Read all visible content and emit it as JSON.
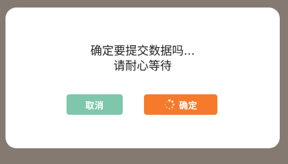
{
  "dialog": {
    "message_line1": "确定要提交数据吗...",
    "message_line2": "请耐心等待",
    "cancel_label": "取消",
    "confirm_label": "确定",
    "confirm_icon": "loading-spinner-icon"
  },
  "colors": {
    "overlay": "#857a72",
    "cancel_button": "#7ec7ad",
    "confirm_button": "#f57a2b",
    "text": "#222222"
  }
}
